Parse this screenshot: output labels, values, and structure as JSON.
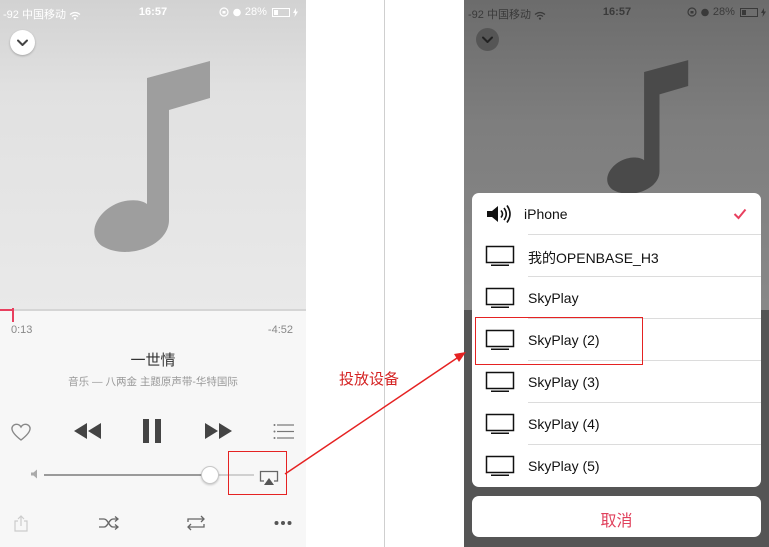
{
  "status_bar": {
    "signal": "-92",
    "carrier": "中国移动",
    "time": "16:57",
    "battery": "28%"
  },
  "player": {
    "elapsed": "0:13",
    "remaining": "-4:52",
    "progress_fraction": 0.043,
    "song_title": "一世情",
    "song_subtitle": "音乐 — 八两金 主题原声带-华特国际",
    "volume_fraction": 0.78
  },
  "annotation": {
    "label": "投放设备"
  },
  "airplay_sheet": {
    "devices": [
      {
        "label": "iPhone",
        "icon": "speaker-icon",
        "selected": true
      },
      {
        "label": "我的OPENBASE_H3",
        "icon": "tv-icon",
        "selected": false
      },
      {
        "label": "SkyPlay",
        "icon": "tv-icon",
        "selected": false
      },
      {
        "label": "SkyPlay (2)",
        "icon": "tv-icon",
        "selected": false
      },
      {
        "label": "SkyPlay (3)",
        "icon": "tv-icon",
        "selected": false
      },
      {
        "label": "SkyPlay (4)",
        "icon": "tv-icon",
        "selected": false
      },
      {
        "label": "SkyPlay (5)",
        "icon": "tv-icon",
        "selected": false
      }
    ],
    "cancel_label": "取消"
  },
  "colors": {
    "accent": "#e8405f",
    "annotation_red": "#e52222"
  }
}
